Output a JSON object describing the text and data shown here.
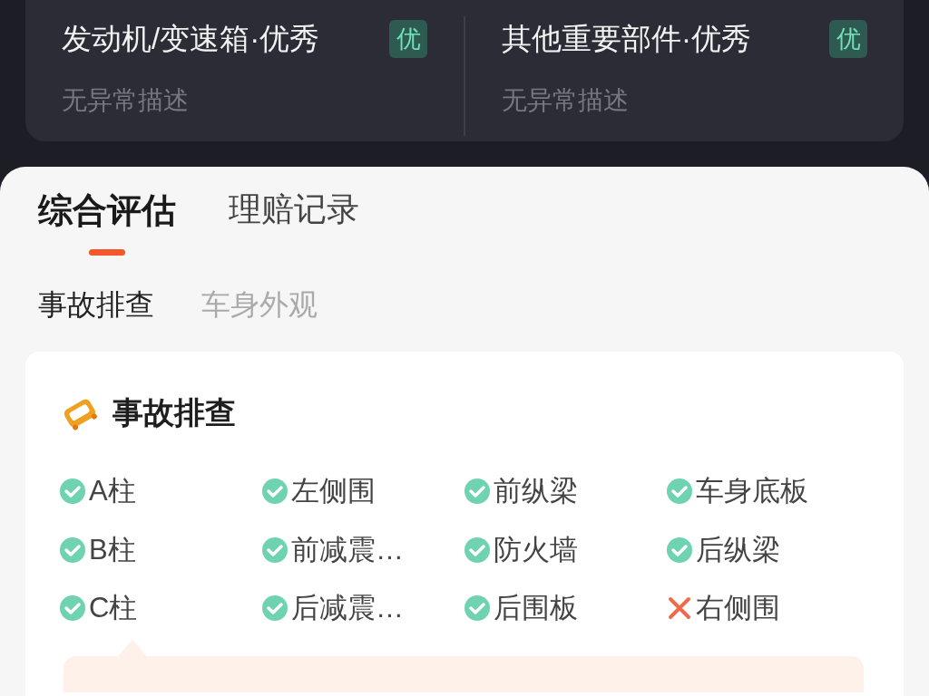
{
  "summary": [
    {
      "title": "发动机/变速箱·优秀",
      "badge": "优",
      "note": "无异常描述"
    },
    {
      "title": "其他重要部件·优秀",
      "badge": "优",
      "note": "无异常描述"
    }
  ],
  "tabs": [
    {
      "label": "综合评估",
      "selected": true
    },
    {
      "label": "理赔记录",
      "selected": false
    }
  ],
  "subtabs": [
    {
      "label": "事故排查",
      "selected": true
    },
    {
      "label": "车身外观",
      "selected": false
    }
  ],
  "section": {
    "title": "事故排查",
    "items": [
      {
        "label": "A柱",
        "kind": "ok"
      },
      {
        "label": "左侧围",
        "kind": "ok"
      },
      {
        "label": "前纵梁",
        "kind": "ok"
      },
      {
        "label": "车身底板",
        "kind": "ok"
      },
      {
        "label": "B柱",
        "kind": "ok"
      },
      {
        "label": "前减震…",
        "kind": "ok"
      },
      {
        "label": "防火墙",
        "kind": "ok"
      },
      {
        "label": "后纵梁",
        "kind": "ok"
      },
      {
        "label": "C柱",
        "kind": "ok"
      },
      {
        "label": "后减震…",
        "kind": "ok"
      },
      {
        "label": "后围板",
        "kind": "ok"
      },
      {
        "label": "右侧围",
        "kind": "repaired"
      }
    ]
  }
}
